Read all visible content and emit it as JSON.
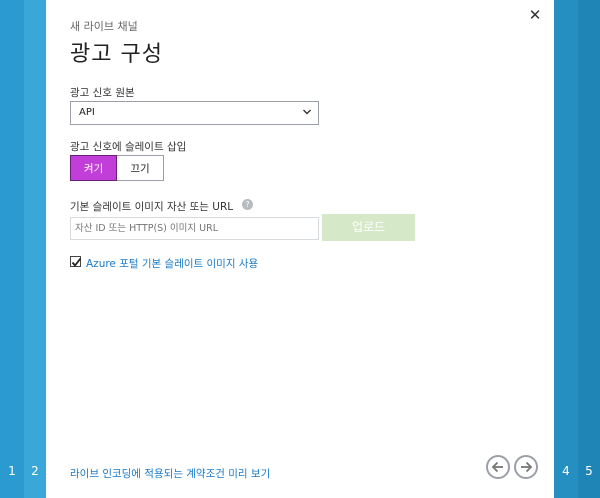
{
  "steps": {
    "s1": "1",
    "s2": "2",
    "s4": "4",
    "s5": "5"
  },
  "dialog": {
    "subtitle": "새 라이브 채널",
    "title": "광고 구성",
    "close_icon": "close-icon",
    "source": {
      "label": "광고 신호 원본",
      "value": "API"
    },
    "slate_insert": {
      "label": "광고 신호에 슬레이트 삽입",
      "on": "켜기",
      "off": "끄기",
      "selected": "켜기"
    },
    "slate_url": {
      "label": "기본 슬레이트 이미지 자산 또는 URL",
      "placeholder": "자산 ID 또는 HTTP(S) 이미지 URL",
      "upload": "업로드"
    },
    "use_default": {
      "label": "Azure 포털 기본 슬레이트 이미지 사용",
      "checked": true
    },
    "footer_link": "라이브 인코딩에 적용되는 계약조건 미리 보기"
  },
  "colors": {
    "accent_toggle": "#c23ed8",
    "link": "#1a7ac8",
    "upload_disabled": "#d5e9c9"
  }
}
